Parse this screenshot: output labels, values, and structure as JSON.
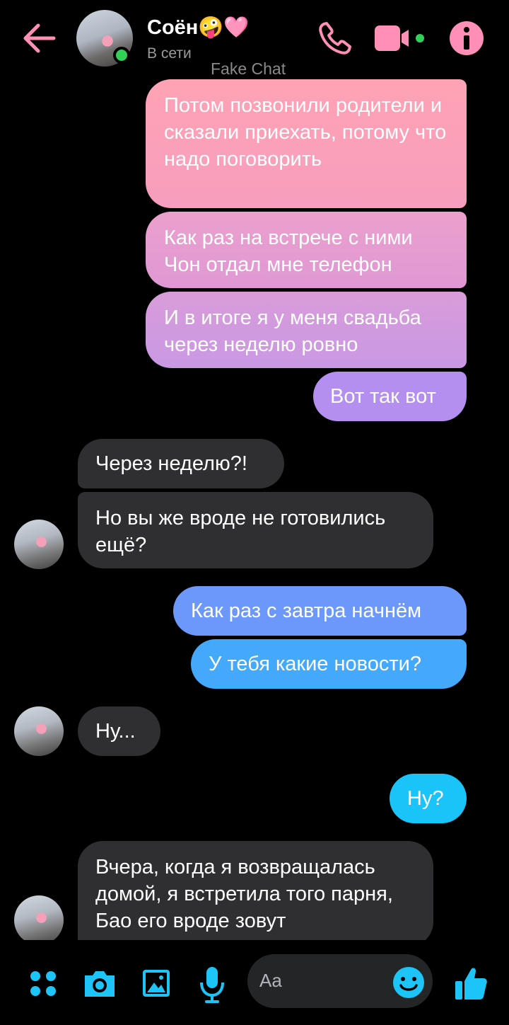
{
  "header": {
    "name": "Соён🤪🩷",
    "status": "В сети",
    "watermark": "Fake Chat",
    "icons": [
      "back-arrow-icon",
      "phone-icon",
      "video-camera-icon",
      "info-icon"
    ],
    "accent_color": "#ff8fb6"
  },
  "messages": [
    {
      "dir": "out",
      "text": "Потом позвонили родители и сказали приехать, потому что надо поговорить",
      "color": "#fd9fb6"
    },
    {
      "dir": "out",
      "text": "Как раз на встрече с ними Чон отдал мне телефон",
      "color": "#e49ad0"
    },
    {
      "dir": "out",
      "text": "И в итоге я у меня свадьба через неделю ровно",
      "color": "#d09ae0"
    },
    {
      "dir": "out",
      "text": "Вот так вот",
      "color": "#b990ef"
    },
    {
      "dir": "in",
      "text": "Через неделю?!"
    },
    {
      "dir": "in",
      "text": "Но вы же вроде не готовились ещё?"
    },
    {
      "dir": "out",
      "text": "Как раз с завтра начнём",
      "color": "#6f99fb"
    },
    {
      "dir": "out",
      "text": "У тебя какие новости?",
      "color": "#46a8fb"
    },
    {
      "dir": "in",
      "text": "Ну..."
    },
    {
      "dir": "out",
      "text": "Ну?",
      "color": "#1cc4f8"
    },
    {
      "dir": "in",
      "text": "Вчера, когда я возвращалась домой, я встретила того парня,  Бао его вроде зовут"
    }
  ],
  "composer": {
    "placeholder": "Aa",
    "icons": [
      "menu-dots-icon",
      "camera-icon",
      "gallery-icon",
      "microphone-icon",
      "emoji-icon",
      "thumbs-up-icon"
    ],
    "icon_color": "#1cc4f8"
  }
}
